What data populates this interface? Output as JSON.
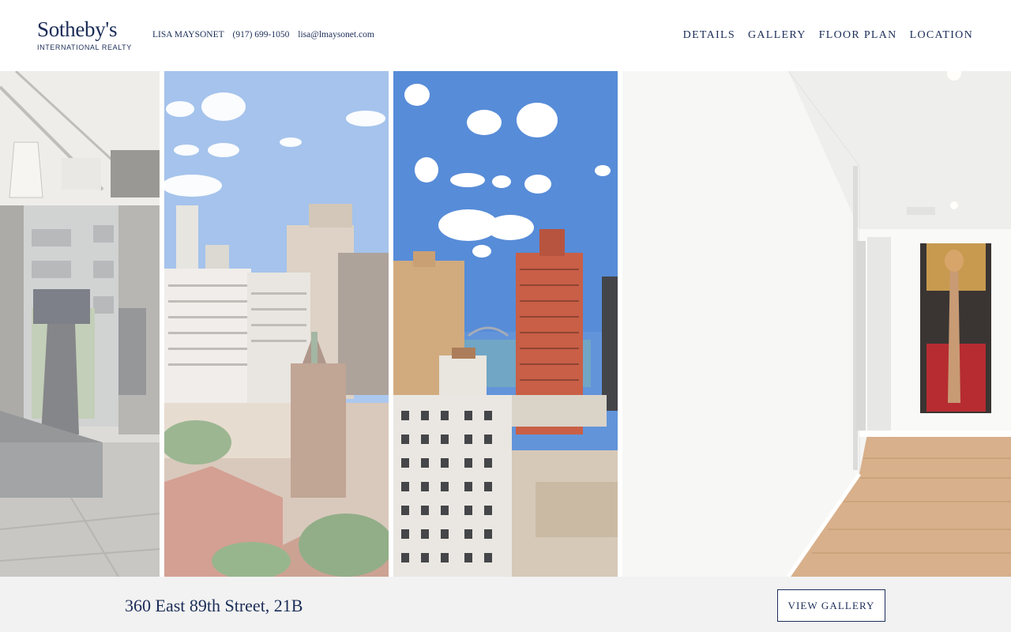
{
  "brand": {
    "name": "Sotheby's",
    "subtitle": "INTERNATIONAL REALTY"
  },
  "contact": {
    "agent": "LISA MAYSONET",
    "phone": "(917) 699-1050",
    "email": "lisa@lmaysonet.com"
  },
  "nav": {
    "items": [
      "DETAILS",
      "GALLERY",
      "FLOOR PLAN",
      "LOCATION"
    ]
  },
  "photos": [
    {
      "subject": "gym"
    },
    {
      "subject": "city-view"
    },
    {
      "subject": "river-view"
    },
    {
      "subject": "hallway"
    }
  ],
  "listing": {
    "address": "360 East 89th Street, 21B",
    "cta": "VIEW GALLERY"
  },
  "colors": {
    "brand_navy": "#1b2d57",
    "footer_bg": "#f2f2f2",
    "sky": "#5a8fd8"
  }
}
